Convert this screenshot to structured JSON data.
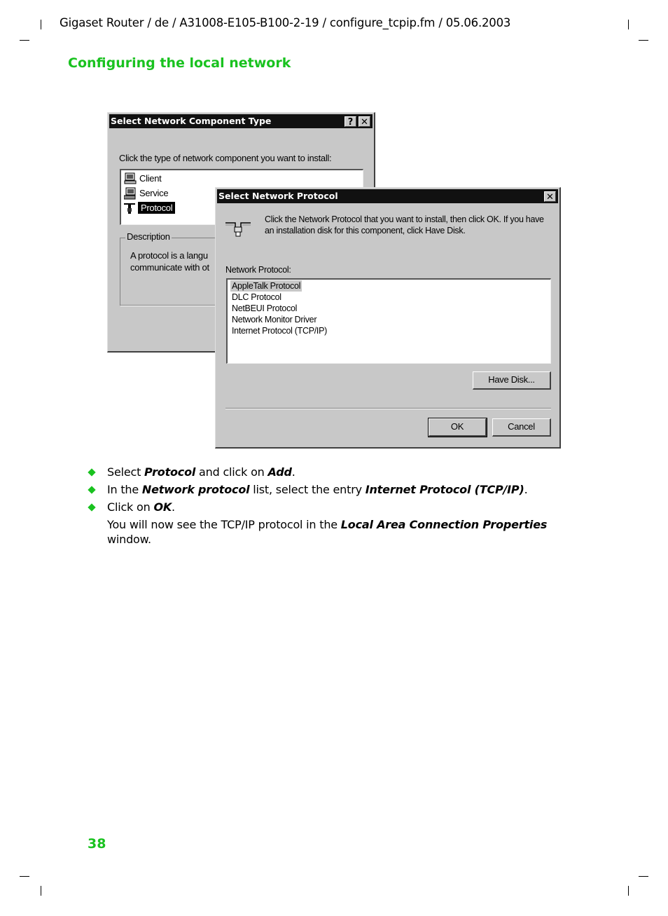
{
  "page": {
    "header": "Gigaset Router / de / A31008-E105-B100-2-19 / configure_tcpip.fm / 05.06.2003",
    "section_title": "Configuring the local network",
    "page_number": "38",
    "accent_color": "#19c21f"
  },
  "dialog_component": {
    "title": "Select Network Component Type",
    "help_button": "?",
    "close_button": "✕",
    "prompt": "Click the type of network component you want to install:",
    "items": [
      {
        "label": "Client",
        "icon": "client-computer-icon"
      },
      {
        "label": "Service",
        "icon": "service-computer-icon"
      },
      {
        "label": "Protocol",
        "icon": "protocol-network-icon",
        "selected": true
      }
    ],
    "description_label": "Description",
    "description_line1": "A protocol is a langu",
    "description_line2": "communicate with ot"
  },
  "dialog_protocol": {
    "title": "Select Network Protocol",
    "close_button": "✕",
    "instructions_line1": "Click the Network Protocol that you want to install, then click OK. If you have",
    "instructions_line2": "an installation disk for this component, click Have Disk.",
    "list_label": "Network Protocol:",
    "protocols": [
      {
        "label": "AppleTalk Protocol",
        "selected": true
      },
      {
        "label": "DLC Protocol"
      },
      {
        "label": "NetBEUI Protocol"
      },
      {
        "label": "Network Monitor Driver"
      },
      {
        "label": "Internet Protocol (TCP/IP)"
      }
    ],
    "have_disk_button": "Have Disk...",
    "ok_button": "OK",
    "cancel_button": "Cancel"
  },
  "steps": [
    {
      "parts": [
        {
          "t": "Select "
        },
        {
          "t": "Protocol",
          "em": true
        },
        {
          "t": " and click on "
        },
        {
          "t": "Add",
          "em": true
        },
        {
          "t": "."
        }
      ]
    },
    {
      "parts": [
        {
          "t": "In the "
        },
        {
          "t": "Network protocol",
          "em": true
        },
        {
          "t": " list, select the entry "
        },
        {
          "t": "Internet Protocol (TCP/IP)",
          "em": true
        },
        {
          "t": "."
        }
      ]
    },
    {
      "parts": [
        {
          "t": "Click on "
        },
        {
          "t": "OK",
          "em": true
        },
        {
          "t": "."
        }
      ]
    }
  ],
  "note": {
    "line1_prefix": "You will now see the TCP/IP protocol in the ",
    "line1_emph": "Local Area Connection Properties",
    "line2": "window."
  }
}
